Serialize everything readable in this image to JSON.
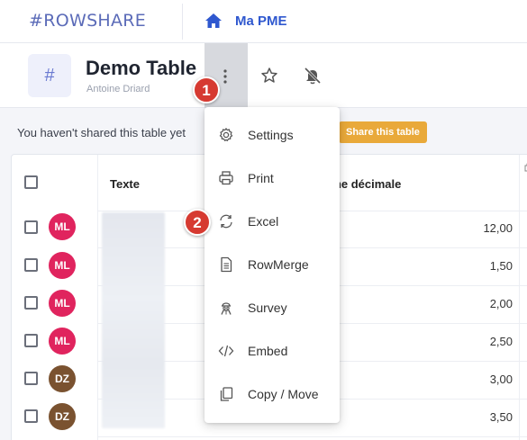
{
  "topbar": {
    "logo": "#ROWSHARE",
    "workspace": "Ma PME"
  },
  "header": {
    "table_icon": "#",
    "title": "Demo Table",
    "owner": "Antoine Driard"
  },
  "share": {
    "message": "You haven't shared this table yet",
    "button": "Share this table"
  },
  "grid": {
    "columns": [
      "Texte",
      "nne décimale"
    ],
    "rows": [
      {
        "initials": "ML",
        "color": "#e0245e",
        "value": "12,00"
      },
      {
        "initials": "ML",
        "color": "#e0245e",
        "value": "1,50"
      },
      {
        "initials": "ML",
        "color": "#e0245e",
        "value": "2,00"
      },
      {
        "initials": "ML",
        "color": "#e0245e",
        "value": "2,50"
      },
      {
        "initials": "DZ",
        "color": "#7a5230",
        "value": "3,00"
      },
      {
        "initials": "DZ",
        "color": "#7a5230",
        "value": "3,50"
      }
    ]
  },
  "menu": {
    "items": [
      {
        "label": "Settings",
        "icon": "gear-icon"
      },
      {
        "label": "Print",
        "icon": "printer-icon"
      },
      {
        "label": "Excel",
        "icon": "sync-icon"
      },
      {
        "label": "RowMerge",
        "icon": "document-icon"
      },
      {
        "label": "Survey",
        "icon": "survey-icon"
      },
      {
        "label": "Embed",
        "icon": "code-icon"
      },
      {
        "label": "Copy / Move",
        "icon": "copy-icon"
      }
    ]
  },
  "callouts": [
    "1",
    "2"
  ],
  "colors": {
    "brand": "#5b6bb8",
    "link": "#2f58cf",
    "share_button": "#e9a93a",
    "callout": "#d63a31"
  }
}
